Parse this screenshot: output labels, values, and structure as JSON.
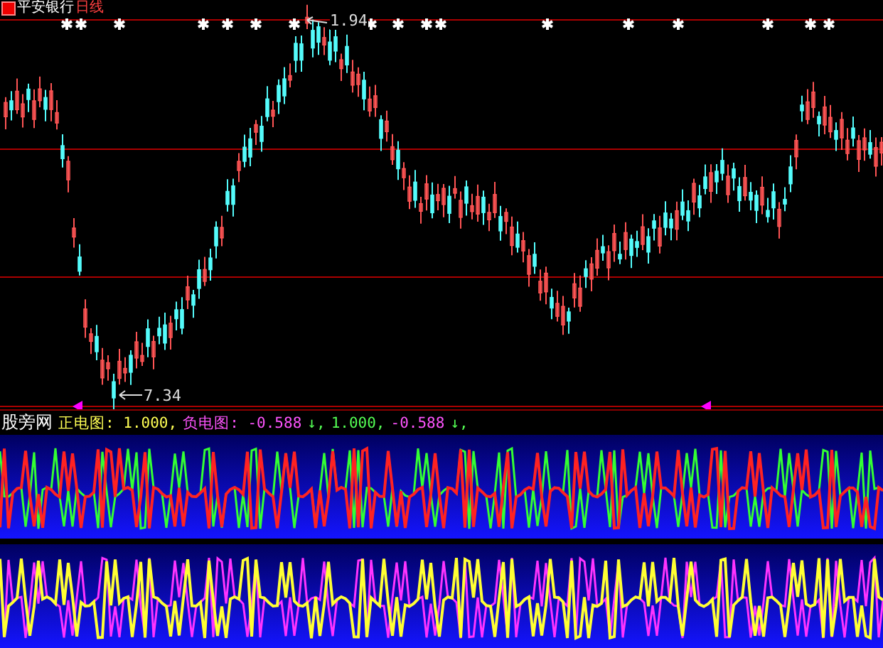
{
  "header": {
    "stock": "平安银行",
    "period": "日线"
  },
  "price_labels": [
    {
      "kind": "high",
      "text": "1.94"
    },
    {
      "kind": "low",
      "text": "7.34"
    }
  ],
  "indicator": {
    "name": "股旁网",
    "legend": [
      {
        "text": "正电图: 1.000,",
        "color": "#ffff54"
      },
      {
        "text": "负电图: -0.588",
        "color": "#ff54ff"
      },
      {
        "text": "↓,",
        "color": "#54ff54"
      },
      {
        "text": "1.000,",
        "color": "#54ff54"
      },
      {
        "text": "-0.588",
        "color": "#ff54ff"
      },
      {
        "text": "↓,",
        "color": "#54ff54"
      }
    ]
  }
}
